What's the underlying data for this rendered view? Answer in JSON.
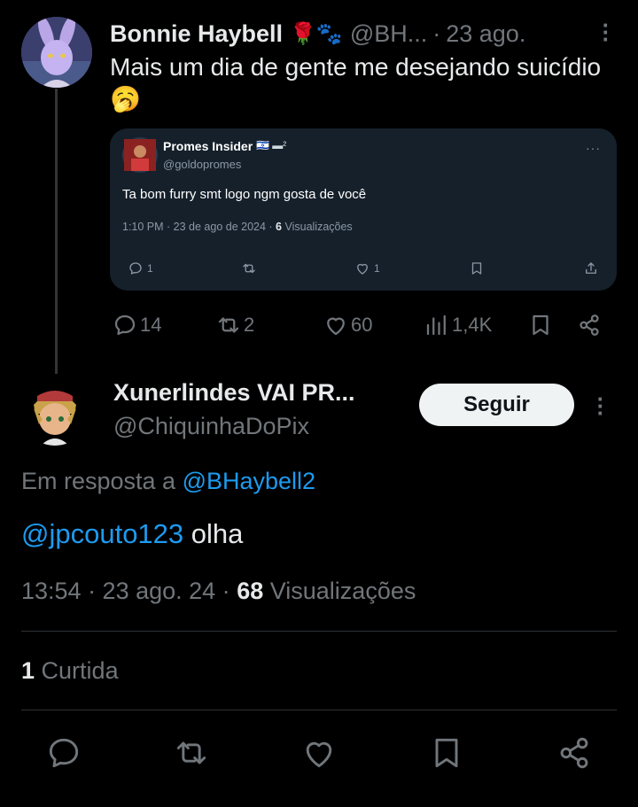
{
  "tweet1": {
    "author_name": "Bonnie Haybell",
    "author_emojis": "🌹🐾",
    "handle": "@BH...",
    "separator": "·",
    "time": "23 ago.",
    "text": "Mais um dia de gente me desejando suicídio 🥱",
    "actions": {
      "replies": "14",
      "retweets": "2",
      "likes": "60",
      "views": "1,4K"
    }
  },
  "quoted": {
    "author_name": "Promes Insider",
    "flags": "🇮🇱 ▬²",
    "handle": "@goldopromes",
    "text": "Ta bom furry smt logo ngm gosta de você",
    "meta_prefix": "1:10 PM · 23 de ago de 2024 · ",
    "views_count": "6",
    "views_label": "Visualizações",
    "actions": {
      "replies": "1",
      "likes": "1"
    }
  },
  "tweet2": {
    "author_name": "Xunerlindes VAI PR...",
    "handle": "@ChiquinhaDoPix",
    "follow_label": "Seguir",
    "reply_to_prefix": "Em resposta a",
    "reply_to_handle": "@BHaybell2",
    "mention": "@jpcouto123",
    "text": "olha",
    "time": "13:54 · 23 ago. 24 ·",
    "views_count": "68",
    "views_label": "Visualizações",
    "likes_count": "1",
    "likes_label": "Curtida"
  },
  "icons": {
    "reply": "speech-bubble-icon",
    "retweet": "retweet-icon",
    "like": "heart-icon",
    "views": "bar-chart-icon",
    "bookmark": "bookmark-icon",
    "share": "share-icon"
  },
  "colors": {
    "background": "#000000",
    "text": "#e7e9ea",
    "muted": "#71767b",
    "link": "#1d9bf0",
    "quote_bg": "#15202b"
  }
}
